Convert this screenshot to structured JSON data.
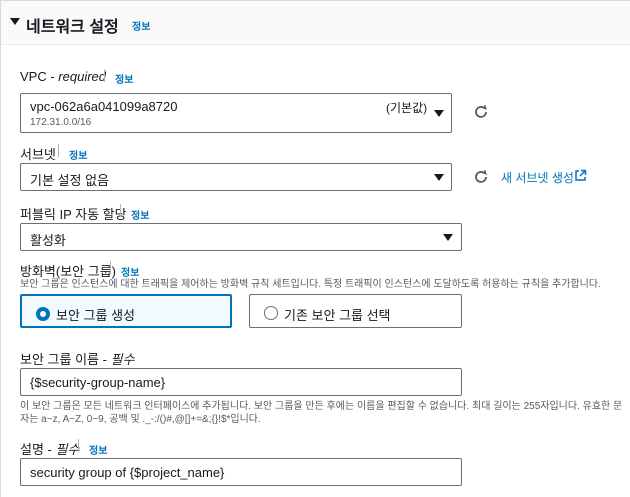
{
  "section": {
    "title": "네트워크 설정",
    "info": "정보"
  },
  "vpc": {
    "label": "VPC - ",
    "required": "required",
    "info": "정보",
    "value": "vpc-062a6a041099a8720",
    "tag": "(기본값)",
    "cidr": "172.31.0.0/16"
  },
  "subnet": {
    "label": "서브넷",
    "info": "정보",
    "value": "기본 설정 없음",
    "new_link": "새 서브넷 생성"
  },
  "public_ip": {
    "label": "퍼블릭 IP 자동 할당",
    "info": "정보",
    "value": "활성화"
  },
  "firewall": {
    "label": "방화벽(보안 그룹)",
    "info": "정보",
    "description": "보안 그룹은 인스턴스에 대한 트래픽을 제어하는 방화벽 규칙 세트입니다. 특정 트래픽이 인스턴스에 도달하도록 허용하는 규칙을 추가합니다.",
    "option_create": "보안 그룹 생성",
    "option_existing": "기존 보안 그룹 선택",
    "selected": "보안 그룹 생성"
  },
  "sg_name": {
    "label": "보안 그룹 이름 - ",
    "required": "필수",
    "value": "{$security-group-name}",
    "help_line1": "이 보안 그룹은 모든 네트워크 인터페이스에 추가됩니다. 보안 그룹을 만든 후에는 이름을 편집할 수 없습니다. 최대 길이는 255자입니다. 유효한 문",
    "help_line2": "자는 a~z, A~Z, 0~9, 공백 및 ._-:/()#,@[]+=&;{}!$*입니다."
  },
  "sg_desc": {
    "label": "설명 - ",
    "required": "필수",
    "info": "정보",
    "value": "security group of {$project_name}"
  },
  "colors": {
    "link": "#0073bb",
    "text": "#16191f",
    "secondary": "#545b64",
    "selected_border": "#0073bb",
    "border": "#687078"
  }
}
